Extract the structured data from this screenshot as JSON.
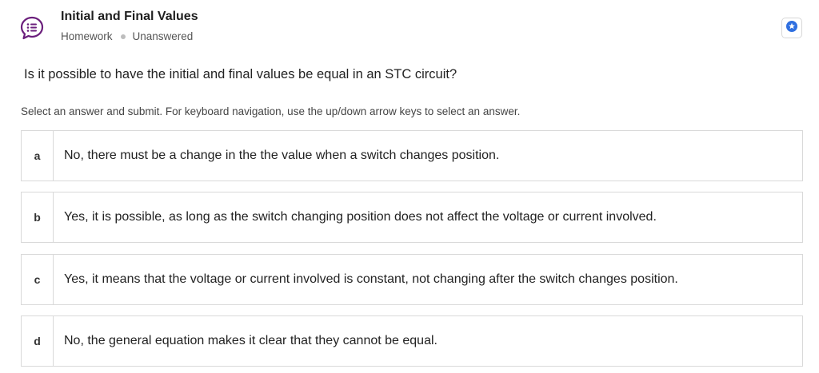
{
  "header": {
    "title": "Initial and Final Values",
    "type": "Homework",
    "status": "Unanswered",
    "icon": "chat-list-icon",
    "bookmark_icon": "star-badge-icon",
    "accent_color": "#6b1f7c",
    "bookmark_color": "#2f6fe0"
  },
  "question": {
    "text": "Is it possible to have the initial and final values be equal in an STC circuit?"
  },
  "instructions": "Select an answer and submit. For keyboard navigation, use the up/down arrow keys to select an answer.",
  "answers": [
    {
      "letter": "a",
      "text": "No, there must be a change in the the value when a switch changes position."
    },
    {
      "letter": "b",
      "text": "Yes, it is possible, as long as the switch changing position does not affect the voltage or current involved."
    },
    {
      "letter": "c",
      "text": "Yes, it means that the voltage or current involved is constant, not changing after the switch changes position."
    },
    {
      "letter": "d",
      "text": "No, the general equation makes it clear that they cannot be equal."
    }
  ]
}
